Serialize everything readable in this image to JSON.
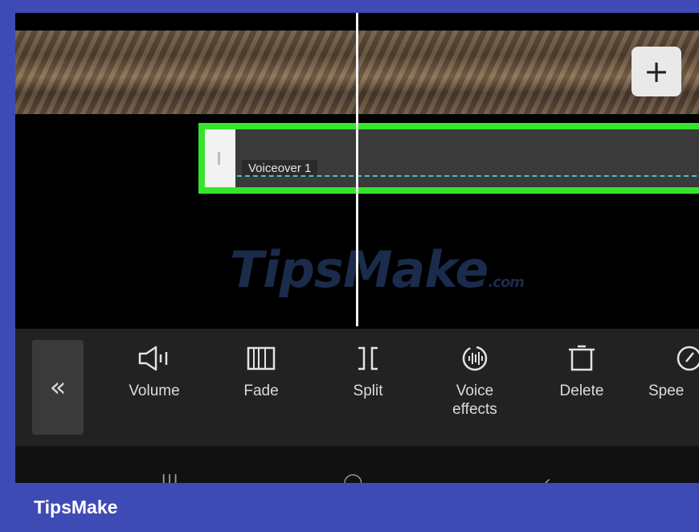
{
  "timeline": {
    "add_button_label": "+",
    "audio_clip_label": "Voiceover 1",
    "watermark_main": "TipsMake",
    "watermark_suffix": ".com"
  },
  "toolbar": {
    "collapse_label": "«",
    "tools": [
      {
        "label": "Volume",
        "icon": "volume-icon"
      },
      {
        "label": "Fade",
        "icon": "fade-icon"
      },
      {
        "label": "Split",
        "icon": "split-icon"
      },
      {
        "label": "Voice\neffects",
        "icon": "voice-effects-icon"
      },
      {
        "label": "Delete",
        "icon": "delete-icon"
      },
      {
        "label": "Spee",
        "icon": "speed-icon"
      }
    ]
  },
  "footer": {
    "brand": "TipsMake"
  },
  "colors": {
    "highlight": "#35e52b",
    "frame": "#3f4bb5",
    "waveform": "#46c1c4"
  }
}
